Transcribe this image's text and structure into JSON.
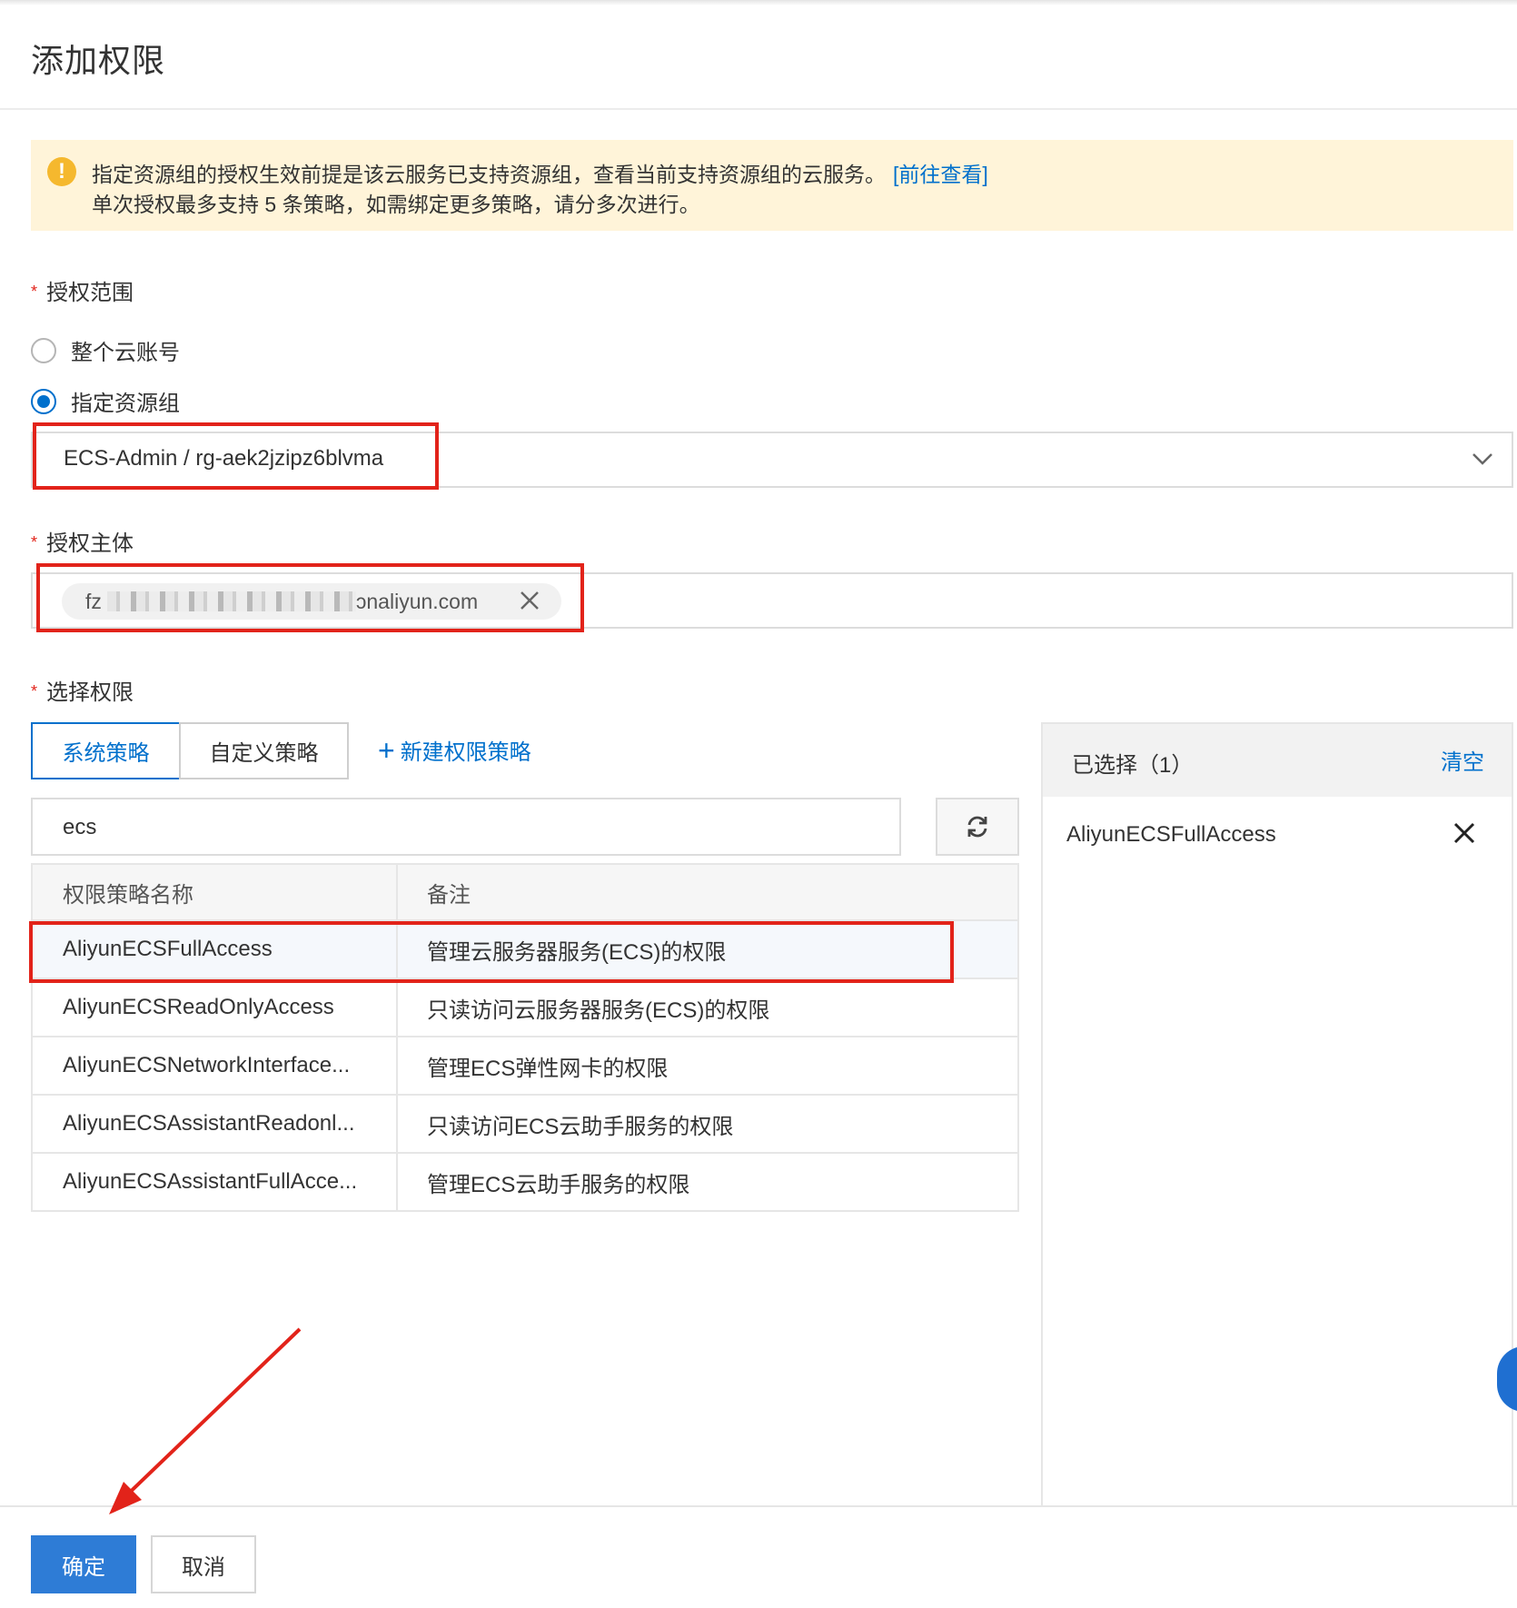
{
  "dialog": {
    "title": "添加权限"
  },
  "notice": {
    "line1": "指定资源组的授权生效前提是该云服务已支持资源组，查看当前支持资源组的云服务。",
    "link": "[前往查看]",
    "line2": "单次授权最多支持 5 条策略，如需绑定更多策略，请分多次进行。",
    "icon": "warning-icon",
    "color": "#f5b82e"
  },
  "scope": {
    "label": "授权范围",
    "options": [
      {
        "label": "整个云账号",
        "checked": false
      },
      {
        "label": "指定资源组",
        "checked": true
      }
    ],
    "selected_group": "ECS-Admin / rg-aek2jzipz6blvma"
  },
  "principal": {
    "label": "授权主体",
    "tag_prefix": "fz",
    "tag_suffix": "ɔnaliyun.com"
  },
  "permissions": {
    "label": "选择权限",
    "tabs": [
      "系统策略",
      "自定义策略"
    ],
    "new_policy": "新建权限策略",
    "search_value": "ecs",
    "columns": [
      "权限策略名称",
      "备注"
    ],
    "rows": [
      {
        "name": "AliyunECSFullAccess",
        "note": "管理云服务器服务(ECS)的权限",
        "selected": true
      },
      {
        "name": "AliyunECSReadOnlyAccess",
        "note": "只读访问云服务器服务(ECS)的权限",
        "selected": false
      },
      {
        "name": "AliyunECSNetworkInterface...",
        "note": "管理ECS弹性网卡的权限",
        "selected": false
      },
      {
        "name": "AliyunECSAssistantReadonl...",
        "note": "只读访问ECS云助手服务的权限",
        "selected": false
      },
      {
        "name": "AliyunECSAssistantFullAcce...",
        "note": "管理ECS云助手服务的权限",
        "selected": false
      }
    ]
  },
  "selected_panel": {
    "title": "已选择（1）",
    "clear": "清空",
    "items": [
      "AliyunECSFullAccess"
    ]
  },
  "footer": {
    "ok": "确定",
    "cancel": "取消"
  },
  "colors": {
    "accent": "#0070cc",
    "primary_button": "#2e7cd6",
    "highlight": "#e2231a",
    "notice_bg": "#fff4d9"
  }
}
